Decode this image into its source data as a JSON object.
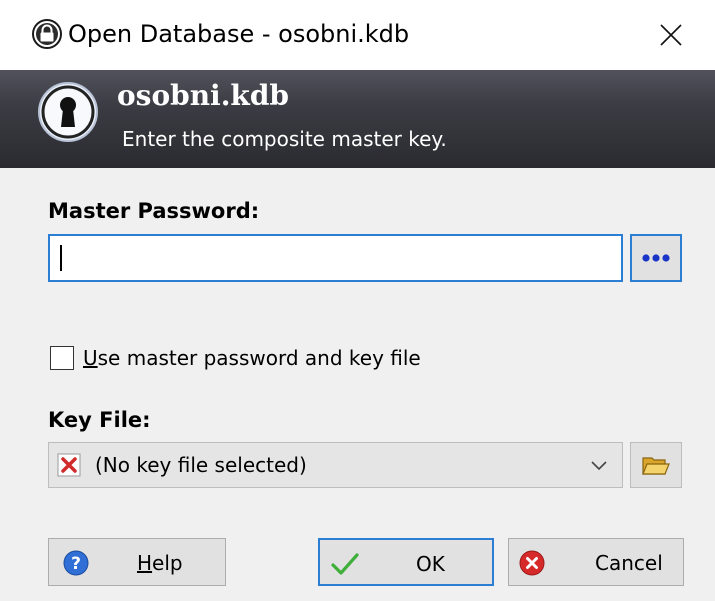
{
  "window": {
    "title": "Open Database - osobni.kdb"
  },
  "banner": {
    "title": "osobni.kdb",
    "subtitle": "Enter the composite master key."
  },
  "master_password": {
    "label": "Master Password:",
    "value": "",
    "reveal_button_glyph": "•••"
  },
  "checkbox": {
    "label_mnemonic": "U",
    "label_rest": "se master password and key file",
    "checked": false
  },
  "key_file": {
    "label": "Key File:",
    "selected": "(No key file selected)"
  },
  "buttons": {
    "help_mnemonic": "H",
    "help_rest": "elp",
    "ok": "OK",
    "cancel": "Cancel"
  },
  "colors": {
    "focus_border": "#2a7fd4",
    "banner_dark": "#2a2a30",
    "dialog_bg": "#f0f0f0"
  },
  "icons": [
    "lock-icon",
    "close-icon",
    "keyhole-icon",
    "reveal-dots-icon",
    "red-x-icon",
    "chevron-down-icon",
    "folder-icon",
    "help-icon",
    "checkmark-icon",
    "cancel-icon"
  ]
}
